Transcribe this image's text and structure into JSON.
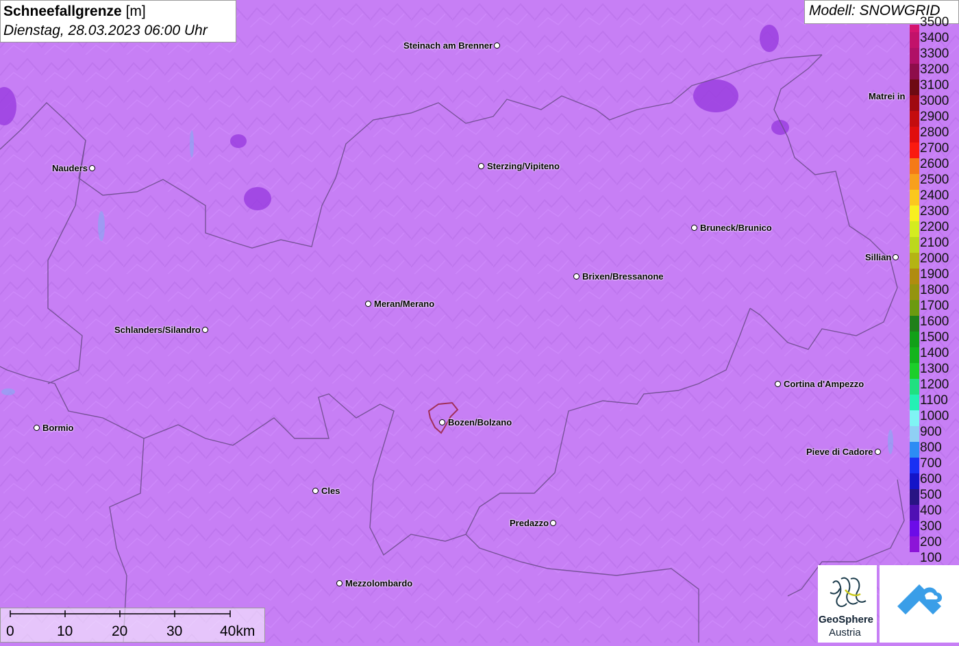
{
  "title": {
    "bold": "Schneefallgrenze",
    "unit": "[m]",
    "datetime": "Dienstag, 28.03.2023 06:00 Uhr"
  },
  "model": "Modell: SNOWGRID",
  "legend": {
    "labels": [
      "3500",
      "3400",
      "3300",
      "3200",
      "3100",
      "3000",
      "2900",
      "2800",
      "2700",
      "2600",
      "2500",
      "2400",
      "2300",
      "2200",
      "2100",
      "2000",
      "1900",
      "1800",
      "1700",
      "1600",
      "1500",
      "1400",
      "1300",
      "1200",
      "1100",
      "1000",
      "900",
      "800",
      "700",
      "600",
      "500",
      "400",
      "300",
      "200",
      "100"
    ],
    "colors": [
      "#d4146e",
      "#c2126a",
      "#b01066",
      "#8e0d4a",
      "#6e0a12",
      "#a00a10",
      "#c40c0e",
      "#e00e0e",
      "#fa1a10",
      "#f57a18",
      "#f8a01c",
      "#fbc81e",
      "#f8f020",
      "#d4ec20",
      "#bcd81c",
      "#b4b414",
      "#b08c10",
      "#949410",
      "#6c9a10",
      "#20801a",
      "#12a018",
      "#14b41c",
      "#1ccf2a",
      "#20e080",
      "#24f0b4",
      "#80f4f4",
      "#90d0f4",
      "#2c8cf4",
      "#1830f4",
      "#1414c8",
      "#281484",
      "#5010b4",
      "#6c0ce8",
      "#8c14d8",
      "#c77ff5"
    ]
  },
  "cities": [
    {
      "name": "Steinach am Brenner",
      "dot": "left"
    },
    {
      "name": "Nauders",
      "dot": "left"
    },
    {
      "name": "Sterzing/Vipiteno",
      "dot": "right"
    },
    {
      "name": "Matrei in",
      "dot": "none"
    },
    {
      "name": "Bruneck/Brunico",
      "dot": "right"
    },
    {
      "name": "Sillian",
      "dot": "left"
    },
    {
      "name": "Brixen/Bressanone",
      "dot": "right"
    },
    {
      "name": "Meran/Merano",
      "dot": "right"
    },
    {
      "name": "Schlanders/Silandro",
      "dot": "left"
    },
    {
      "name": "Cortina d'Ampezzo",
      "dot": "right"
    },
    {
      "name": "Bormio",
      "dot": "right"
    },
    {
      "name": "Bozen/Bolzano",
      "dot": "right"
    },
    {
      "name": "Pieve di Cadore",
      "dot": "left"
    },
    {
      "name": "Cles",
      "dot": "right"
    },
    {
      "name": "Predazzo",
      "dot": "left"
    },
    {
      "name": "Mezzolombardo",
      "dot": "right"
    }
  ],
  "scale": {
    "ticks": [
      "0",
      "10",
      "20",
      "30",
      "40km"
    ]
  },
  "logos": {
    "geosphere_line1": "GeoSphere",
    "geosphere_line2": "Austria"
  }
}
